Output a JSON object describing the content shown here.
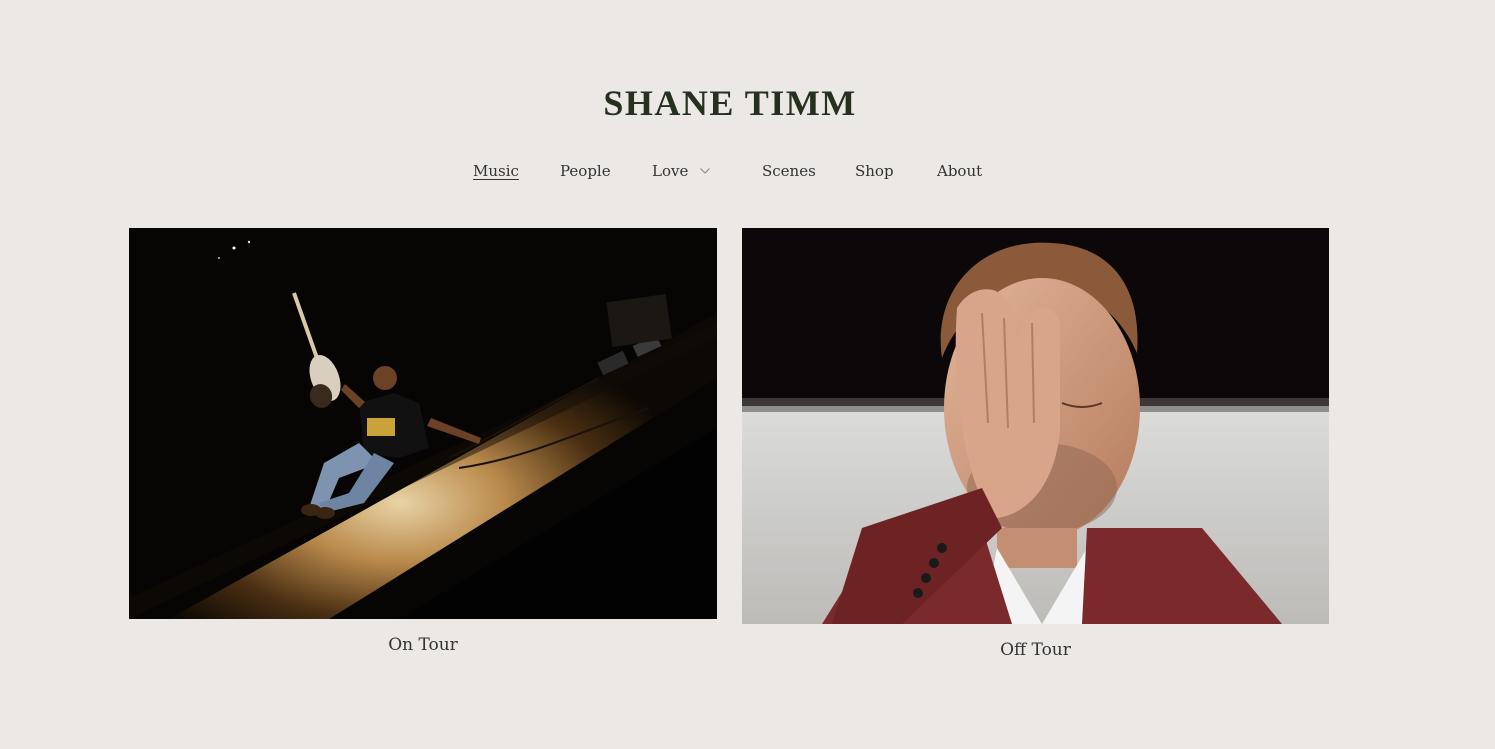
{
  "header": {
    "site_title": "SHANE TIMM"
  },
  "nav": {
    "items": [
      {
        "label": "Music",
        "active": true
      },
      {
        "label": "People"
      },
      {
        "label": "Love",
        "has_dropdown": true
      },
      {
        "label": "Scenes"
      },
      {
        "label": "Shop"
      },
      {
        "label": "About"
      }
    ]
  },
  "gallery": {
    "items": [
      {
        "caption": "On Tour",
        "image": "photo of musician sitting on a lit stage holding a bass guitar, wearing a black t-shirt with yellow print reading WELCOME TO WHEREVER"
      },
      {
        "caption": "Off Tour",
        "image": "portrait of man with hand over half of his face, wearing a dark red suit jacket and white shirt"
      }
    ]
  },
  "colors": {
    "background": "#ebe8e5",
    "title": "#25301f",
    "text": "#333333"
  }
}
